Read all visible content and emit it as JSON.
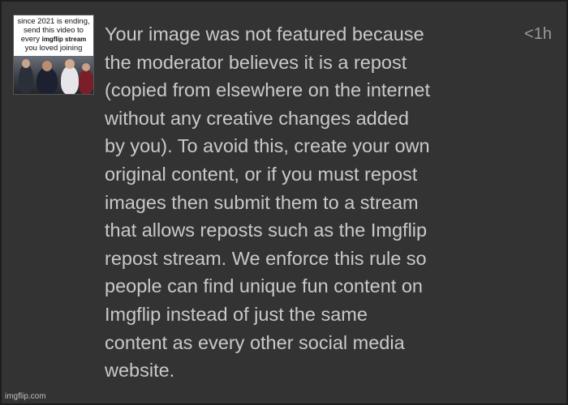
{
  "thumbnail": {
    "caption_lines": [
      "since 2021 is ending,",
      "send this video to",
      "every",
      "imgflip stream",
      "you loved joining"
    ]
  },
  "notification": {
    "timestamp": "<1h",
    "message_lines": [
      "Your image was not featured because",
      "the moderator believes it is a repost",
      "(copied from elsewhere on the internet",
      "without any creative changes added",
      "by you). To avoid this, create your own",
      "original content, or if you must repost",
      "images then submit them to a stream",
      "that allows reposts such as the Imgflip",
      "repost stream. We enforce this rule so",
      "people can find unique fun content on",
      "Imgflip instead of just the same",
      "content as every other social media",
      "website."
    ]
  },
  "watermark": "imgflip.com",
  "colors": {
    "background": "#333333",
    "text": "#c9c9c9",
    "timestamp": "#9a9a9a"
  }
}
